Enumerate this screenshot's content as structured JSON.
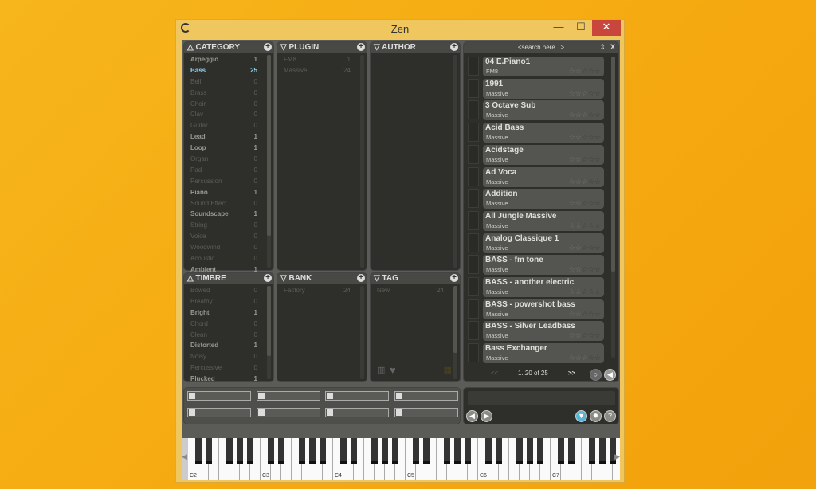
{
  "window": {
    "title": "Zen",
    "minimize": "—",
    "maximize": "☐",
    "close": "✕",
    "icon": "loading-ring-icon"
  },
  "category": {
    "title": "CATEGORY",
    "items": [
      {
        "label": "Arpeggio",
        "count": "1",
        "state": "on"
      },
      {
        "label": "Bass",
        "count": "25",
        "state": "sel"
      },
      {
        "label": "Bell",
        "count": "0"
      },
      {
        "label": "Brass",
        "count": "0"
      },
      {
        "label": "Choir",
        "count": "0"
      },
      {
        "label": "Clav",
        "count": "0"
      },
      {
        "label": "Guitar",
        "count": "0"
      },
      {
        "label": "Lead",
        "count": "1",
        "state": "on"
      },
      {
        "label": "Loop",
        "count": "1",
        "state": "on"
      },
      {
        "label": "Organ",
        "count": "0"
      },
      {
        "label": "Pad",
        "count": "0"
      },
      {
        "label": "Percussion",
        "count": "0"
      },
      {
        "label": "Piano",
        "count": "1",
        "state": "on"
      },
      {
        "label": "Sound Effect",
        "count": "0"
      },
      {
        "label": "Soundscape",
        "count": "1",
        "state": "on"
      },
      {
        "label": "String",
        "count": "0"
      },
      {
        "label": "Voice",
        "count": "0"
      },
      {
        "label": "Woodwind",
        "count": "0"
      },
      {
        "label": "Acoustic",
        "count": "0"
      },
      {
        "label": "Ambient",
        "count": "1",
        "state": "on"
      }
    ]
  },
  "plugin": {
    "title": "PLUGIN",
    "items": [
      {
        "label": "FM8",
        "count": "1"
      },
      {
        "label": "Massive",
        "count": "24"
      }
    ]
  },
  "author": {
    "title": "AUTHOR",
    "items": []
  },
  "timbre": {
    "title": "TIMBRE",
    "items": [
      {
        "label": "Bowed",
        "count": "0"
      },
      {
        "label": "Breathy",
        "count": "0"
      },
      {
        "label": "Bright",
        "count": "1",
        "state": "on"
      },
      {
        "label": "Chord",
        "count": "0"
      },
      {
        "label": "Clean",
        "count": "0"
      },
      {
        "label": "Distorted",
        "count": "1",
        "state": "on"
      },
      {
        "label": "Noisy",
        "count": "0"
      },
      {
        "label": "Percussive",
        "count": "0"
      },
      {
        "label": "Plucked",
        "count": "1",
        "state": "on"
      }
    ]
  },
  "bank": {
    "title": "BANK",
    "items": [
      {
        "label": "Factory",
        "count": "24"
      }
    ]
  },
  "tag": {
    "title": "TAG",
    "items": [
      {
        "label": "New",
        "count": "24"
      }
    ]
  },
  "search": {
    "placeholder": "<search here...>",
    "sort_icon": "⇕",
    "clear": "X"
  },
  "presets": [
    {
      "name": "04 E.Piano1",
      "plugin": "FM8",
      "rating": 2
    },
    {
      "name": "1991",
      "plugin": "Massive",
      "rating": 3
    },
    {
      "name": "3 Octave Sub",
      "plugin": "Massive",
      "rating": 3
    },
    {
      "name": "Acid Bass",
      "plugin": "Massive",
      "rating": 2
    },
    {
      "name": "Acidstage",
      "plugin": "Massive",
      "rating": 2
    },
    {
      "name": "Ad Voca",
      "plugin": "Massive",
      "rating": 3
    },
    {
      "name": "Addition",
      "plugin": "Massive",
      "rating": 2
    },
    {
      "name": "All Jungle Massive",
      "plugin": "Massive",
      "rating": 2
    },
    {
      "name": "Analog Classique 1",
      "plugin": "Massive",
      "rating": 2
    },
    {
      "name": "BASS -  fm tone",
      "plugin": "Massive",
      "rating": 2
    },
    {
      "name": "BASS - another electric",
      "plugin": "Massive",
      "rating": 2
    },
    {
      "name": "BASS - powershot bass",
      "plugin": "Massive",
      "rating": 2
    },
    {
      "name": "BASS - Silver Leadbass",
      "plugin": "Massive",
      "rating": 2
    },
    {
      "name": "Bass Exchanger",
      "plugin": "Massive",
      "rating": 3
    }
  ],
  "pager": {
    "prev": "<<",
    "range": "1..20 of 25",
    "next": ">>"
  },
  "keyboard": {
    "labels": [
      "C2",
      "C3",
      "C4",
      "C5",
      "C6",
      "C7"
    ]
  },
  "colors": {
    "selected": "#8fd3f0",
    "window": "#f0c65e",
    "close": "#c9463d"
  }
}
